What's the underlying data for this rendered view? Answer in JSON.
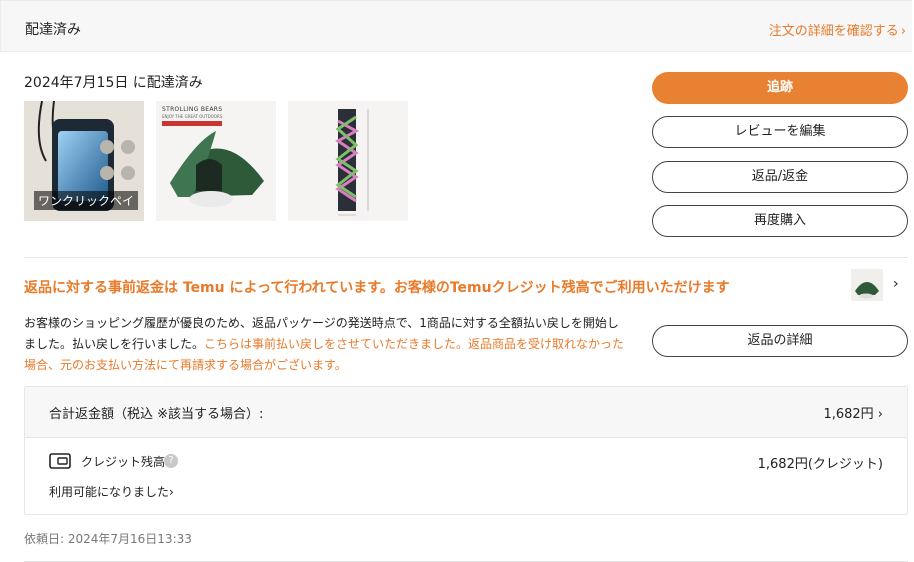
{
  "header": {
    "title": "配達済み",
    "details_link": "注文の詳細を確認する"
  },
  "delivery": {
    "status_text": "2024年7月15日 に配達済み"
  },
  "items": [
    {
      "name": "phone-pouch",
      "badge": "ワンクリックペイ"
    },
    {
      "name": "tent",
      "brand": "STROLLING BEARS",
      "brand_sub": "ENJOY THE GREAT OUTDOORS"
    },
    {
      "name": "long-bag"
    }
  ],
  "actions": {
    "track": "追跡",
    "edit_review": "レビューを編集",
    "return_refund": "返品/返金",
    "buy_again": "再度購入"
  },
  "refund": {
    "title": "返品に対する事前返金は Temu によって行われています。お客様のTemuクレジット残高でご利用いただけます",
    "notice_plain": "お客様のショッピング履歴が優良のため、返品パッケージの発送時点で、1商品に対する全額払い戻しを開始しました。払い戻しを行いました。",
    "notice_orange": "こちらは事前払い戻しをさせていただきました。返品商品を受け取れなかった場合、元のお支払い方法にて再請求する場合がございます。",
    "details_button": "返品の詳細"
  },
  "summary": {
    "total_label": "合計返金額（税込 ※該当する場合）:",
    "total_value": "1,682円",
    "credit_label": "クレジット残高",
    "help_glyph": "?",
    "credit_value": "1,682円(クレジット)",
    "available": "利用可能になりました"
  },
  "request": {
    "date": "依頼日: 2024年7月16日13:33"
  },
  "colors": {
    "accent": "#e98133",
    "accent_text": "#e97a29",
    "border": "#e6e6e6"
  }
}
